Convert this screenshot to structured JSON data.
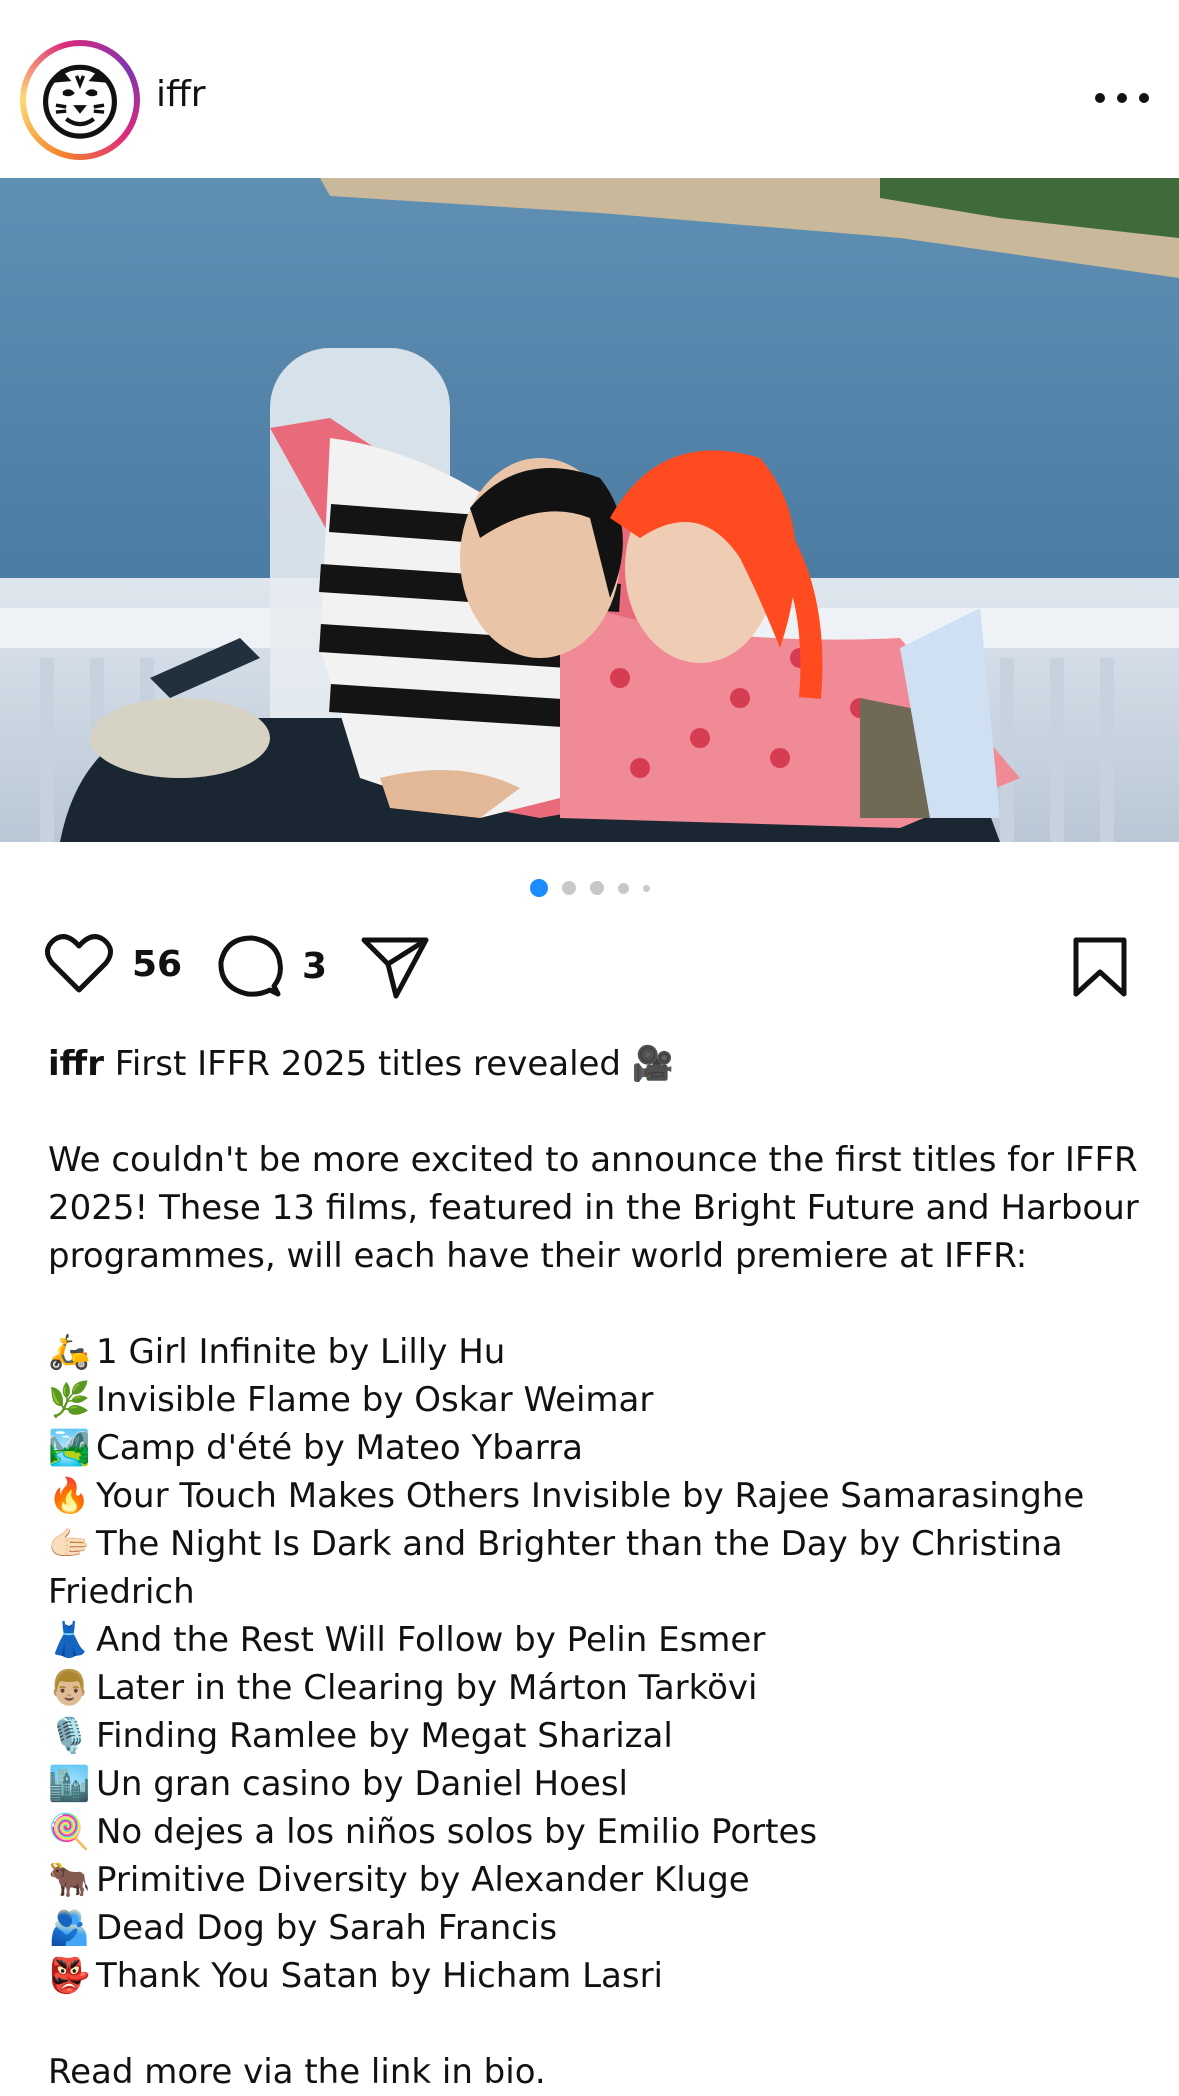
{
  "header": {
    "username": "iffr"
  },
  "carousel": {
    "total": 5,
    "active": 1
  },
  "actions": {
    "likes": "56",
    "comments": "3"
  },
  "caption": {
    "username": "iffr",
    "headline": "First IFFR 2025 titles revealed 🎥",
    "intro": "We couldn't be more excited to announce the first titles for IFFR 2025! These 13 films, featured in the Bright Future and Harbour programmes, will each have their world premiere at IFFR:",
    "films": [
      {
        "emoji": "🛵",
        "text": "1 Girl Infinite by Lilly Hu"
      },
      {
        "emoji": "🌿",
        "text": "Invisible Flame by Oskar Weimar"
      },
      {
        "emoji": "🏞️",
        "text": "Camp d'été by Mateo Ybarra"
      },
      {
        "emoji": "🔥",
        "text": "Your Touch Makes Others Invisible by Rajee Samarasinghe"
      },
      {
        "emoji": "🫱🏻",
        "text": "The Night Is Dark and Brighter than the Day by Christina Friedrich"
      },
      {
        "emoji": "👗",
        "text": "And the Rest Will Follow by Pelin Esmer"
      },
      {
        "emoji": "👨🏼",
        "text": "Later in the Clearing by Márton Tarkövi"
      },
      {
        "emoji": "🎙️",
        "text": "Finding Ramlee by Megat Sharizal"
      },
      {
        "emoji": "🏙️",
        "text": "Un gran casino by Daniel Hoesl"
      },
      {
        "emoji": "🍭",
        "text": "No dejes a los niños solos by Emilio Portes"
      },
      {
        "emoji": "🐂",
        "text": "Primitive Diversity by Alexander Kluge"
      },
      {
        "emoji": "🫂",
        "text": "Dead Dog by Sarah Francis"
      },
      {
        "emoji": "👺",
        "text": "Thank You Satan by Hicham Lasri"
      }
    ],
    "outro": "Read more via the link in bio."
  }
}
